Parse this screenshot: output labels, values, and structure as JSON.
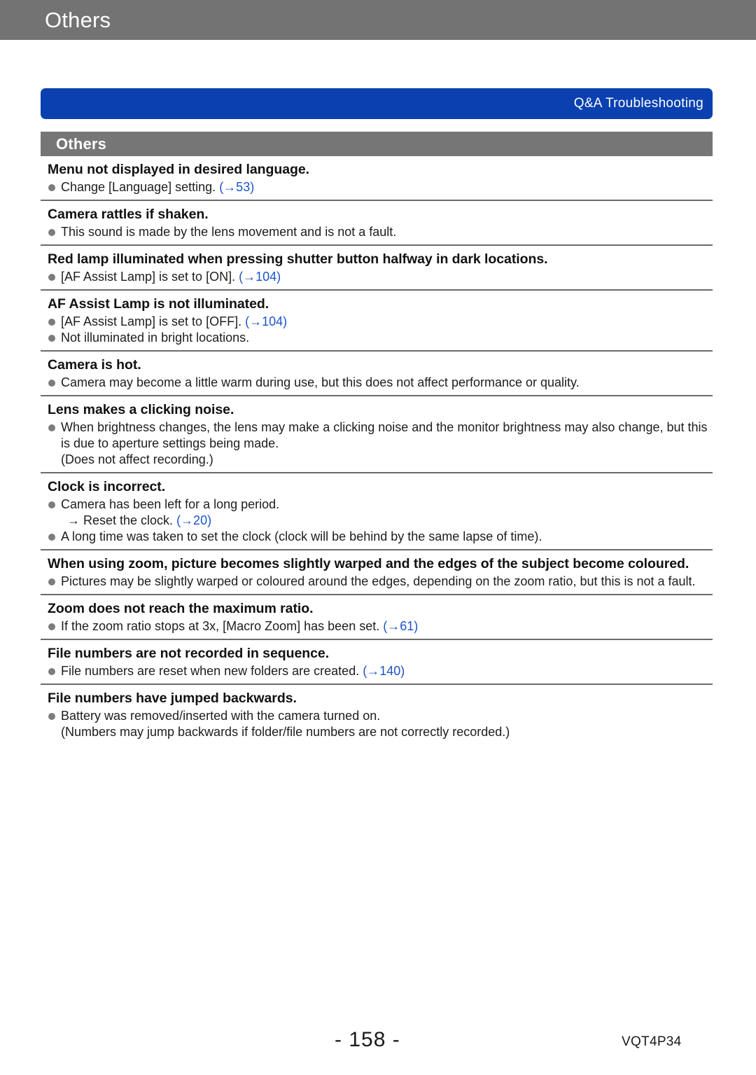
{
  "page_header": {
    "title": "Others"
  },
  "banner": {
    "label": "Q&A  Troubleshooting",
    "color": "#0a40b0"
  },
  "section": {
    "title": "Others",
    "color": "#767676"
  },
  "link_color": "#1a54c8",
  "entries": [
    {
      "question": "Menu not displayed in desired language.",
      "answers": [
        {
          "text": "Change [Language] setting. ",
          "ref": "(→53)"
        }
      ]
    },
    {
      "question": "Camera rattles if shaken.",
      "answers": [
        {
          "text": "This sound is made by the lens movement and is not a fault.",
          "ref": ""
        }
      ]
    },
    {
      "question": "Red lamp illuminated when pressing shutter button halfway in dark locations.",
      "answers": [
        {
          "text": "[AF Assist Lamp] is set to [ON]. ",
          "ref": "(→104)"
        }
      ]
    },
    {
      "question": "AF Assist Lamp is not illuminated.",
      "answers": [
        {
          "text": "[AF Assist Lamp] is set to [OFF]. ",
          "ref": "(→104)"
        },
        {
          "text": "Not illuminated in bright locations.",
          "ref": ""
        }
      ]
    },
    {
      "question": "Camera is hot.",
      "answers": [
        {
          "text": "Camera may become a little warm during use, but this does not affect performance or quality.",
          "ref": ""
        }
      ]
    },
    {
      "question": "Lens makes a clicking noise.",
      "answers": [
        {
          "text": "When brightness changes, the lens may make a clicking noise and the monitor brightness may also change, but this is due to aperture settings being made.",
          "ref": "",
          "extra": "(Does not affect recording.)"
        }
      ]
    },
    {
      "question": "Clock is incorrect.",
      "answers": [
        {
          "text": "Camera has been left for a long period.",
          "ref": "",
          "sub_text": "→ Reset the clock. ",
          "sub_ref": "(→20)"
        },
        {
          "text": "A long time was taken to set the clock (clock will be behind by the same lapse of time).",
          "ref": ""
        }
      ]
    },
    {
      "question": "When using zoom, picture becomes slightly warped and the edges of the subject become coloured.",
      "answers": [
        {
          "text": "Pictures may be slightly warped or coloured around the edges, depending on the zoom ratio, but this is not a fault.",
          "ref": ""
        }
      ]
    },
    {
      "question": "Zoom does not reach the maximum ratio.",
      "answers": [
        {
          "text": "If the zoom ratio stops at 3x, [Macro Zoom] has been set. ",
          "ref": "(→61)"
        }
      ]
    },
    {
      "question": "File numbers are not recorded in sequence.",
      "answers": [
        {
          "text": "File numbers are reset when new folders are created. ",
          "ref": "(→140)"
        }
      ]
    },
    {
      "question": "File numbers have jumped backwards.",
      "answers": [
        {
          "text": "Battery was removed/inserted with the camera turned on.",
          "ref": "",
          "extra": "(Numbers may jump backwards if folder/file numbers are not correctly recorded.)"
        }
      ]
    }
  ],
  "footer": {
    "page_number": "- 158 -",
    "document_code": "VQT4P34"
  }
}
